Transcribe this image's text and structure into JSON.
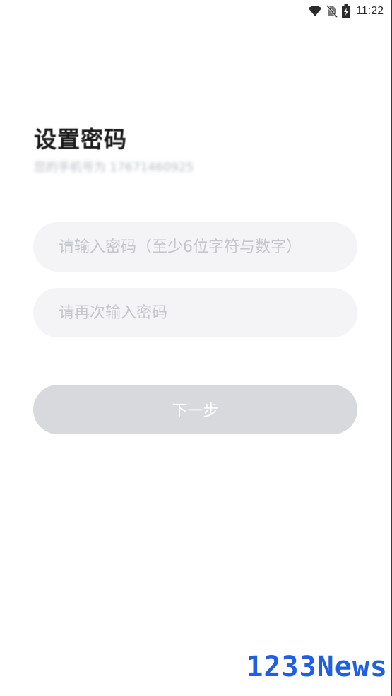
{
  "status_bar": {
    "time": "11:22",
    "icons": [
      "wifi-icon",
      "no-sim-icon",
      "battery-charging-icon"
    ]
  },
  "title": "设置密码",
  "phone_hint": "您的手机号为 17671460925",
  "inputs": {
    "password_placeholder": "请输入密码（至少6位字符与数字）",
    "confirm_placeholder": "请再次输入密码",
    "password_value": "",
    "confirm_value": ""
  },
  "next_button": {
    "label": "下一步",
    "enabled": false,
    "color": "#d8d9dd"
  },
  "watermark": "1233News",
  "colors": {
    "field_bg": "#f4f4f6",
    "placeholder": "#c4c6cb",
    "watermark": "#1f5fe0"
  }
}
